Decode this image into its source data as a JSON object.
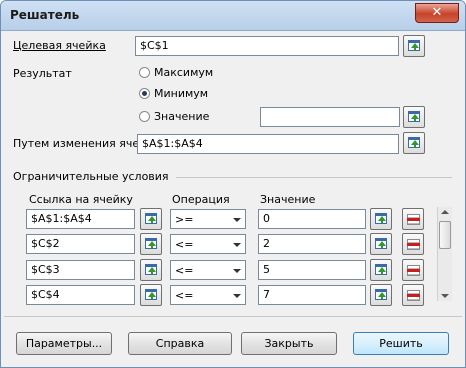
{
  "window": {
    "title": "Решатель",
    "close_glyph": "✕"
  },
  "target_cell": {
    "label": "Целевая ячейка",
    "value": "$C$1"
  },
  "result": {
    "label": "Результат",
    "options": [
      {
        "label": "Максимум",
        "selected": false
      },
      {
        "label": "Минимум",
        "selected": true
      },
      {
        "label": "Значение",
        "selected": false
      }
    ],
    "value_field": ""
  },
  "changing_cells": {
    "label": "Путем изменения ячеек",
    "value": "$A$1:$A$4"
  },
  "constraints": {
    "section_label": "Ограничительные условия",
    "headers": {
      "cell_ref": "Ссылка на ячейку",
      "operator": "Операция",
      "value": "Значение"
    },
    "rows": [
      {
        "cell": "$A$1:$A$4",
        "op": ">=",
        "value": "0"
      },
      {
        "cell": "$C$2",
        "op": "<=",
        "value": "2"
      },
      {
        "cell": "$C$3",
        "op": "<=",
        "value": "5"
      },
      {
        "cell": "$C$4",
        "op": "<=",
        "value": "7"
      }
    ]
  },
  "buttons": {
    "options": "Параметры...",
    "help": "Справка",
    "close": "Закрыть",
    "solve": "Решить"
  },
  "icons": {
    "shrink": "shrink-dialog-icon",
    "delete": "delete-row-icon"
  },
  "colors": {
    "accent": "#3c7fb1",
    "delete_red": "#c81e1e",
    "arrow_green": "#2f9a2a"
  }
}
